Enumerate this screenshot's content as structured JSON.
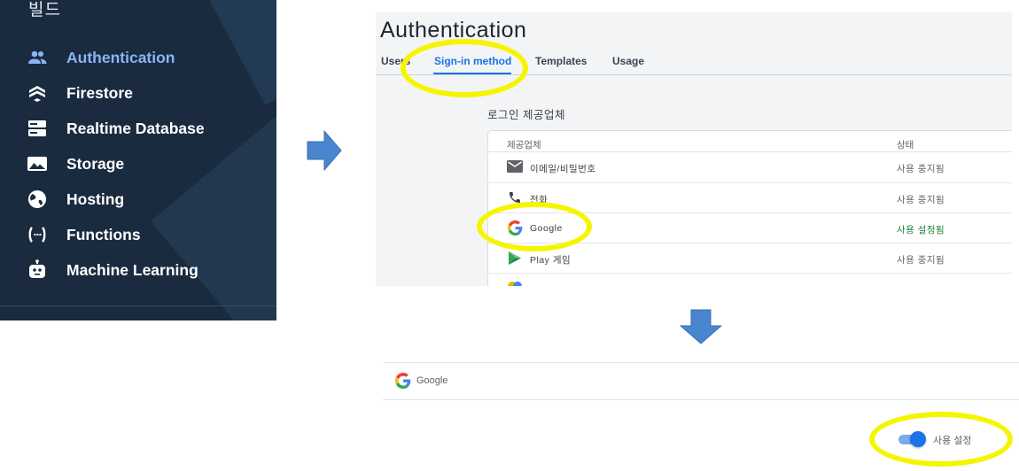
{
  "sidebar": {
    "section_title": "빌드",
    "items": [
      {
        "label": "Authentication",
        "icon": "people-icon",
        "active": true
      },
      {
        "label": "Firestore",
        "icon": "firestore-icon"
      },
      {
        "label": "Realtime Database",
        "icon": "database-icon"
      },
      {
        "label": "Storage",
        "icon": "image-icon"
      },
      {
        "label": "Hosting",
        "icon": "globe-icon"
      },
      {
        "label": "Functions",
        "icon": "functions-icon"
      },
      {
        "label": "Machine Learning",
        "icon": "robot-icon"
      }
    ]
  },
  "auth": {
    "title": "Authentication",
    "tabs": [
      {
        "label": "Users"
      },
      {
        "label": "Sign-in method",
        "active": true
      },
      {
        "label": "Templates"
      },
      {
        "label": "Usage"
      }
    ],
    "providers_heading": "로그인 제공업체",
    "table": {
      "col_provider": "제공업체",
      "col_status": "상태",
      "rows": [
        {
          "name": "이메일/비밀번호",
          "status": "사용 중지됨",
          "icon": "email-icon"
        },
        {
          "name": "전화",
          "status": "사용 중지됨",
          "icon": "phone-icon"
        },
        {
          "name": "Google",
          "status": "사용 설정됨",
          "icon": "google-icon"
        },
        {
          "name": "Play 게임",
          "status": "사용 중지됨",
          "icon": "play-games-icon"
        }
      ]
    }
  },
  "detail": {
    "provider_name": "Google",
    "toggle_label": "사용 설정",
    "toggle_on": true
  },
  "colors": {
    "sidebar_bg": "#1a2b3f",
    "accent": "#1a73e8",
    "highlight": "#f5f500",
    "arrow": "#4a86cf",
    "enabled": "#188038"
  }
}
